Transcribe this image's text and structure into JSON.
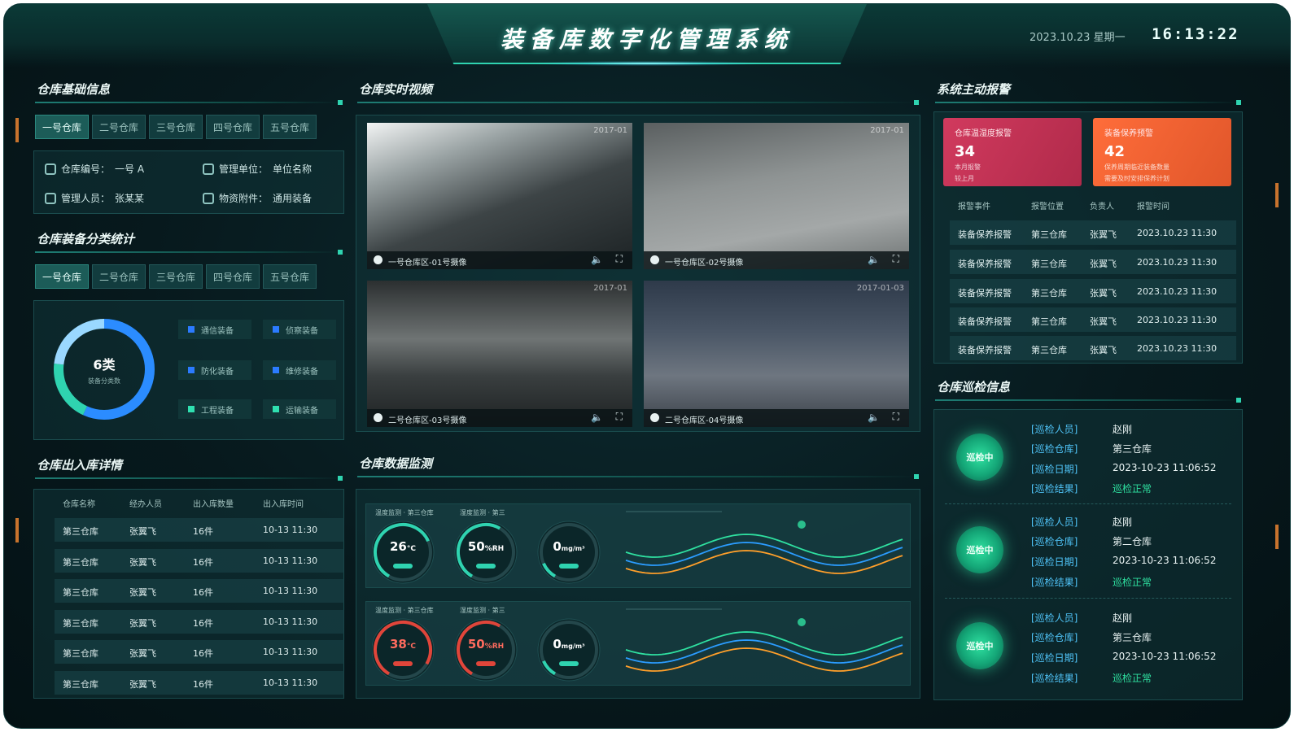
{
  "header": {
    "title": "装备库数字化管理系统",
    "date": "2023.10.23  星期一",
    "time": "16:13:22"
  },
  "basic_info": {
    "title": "仓库基础信息",
    "tabs": [
      "一号仓库",
      "二号仓库",
      "三号仓库",
      "四号仓库",
      "五号仓库"
    ],
    "active_tab": 0,
    "fields": [
      {
        "label": "仓库编号：",
        "value": "一号 A"
      },
      {
        "label": "管理单位：",
        "value": "单位名称"
      },
      {
        "label": "管理人员：",
        "value": "张某某"
      },
      {
        "label": "物资附件：",
        "value": "通用装备"
      }
    ]
  },
  "category_stats": {
    "title": "仓库装备分类统计",
    "tabs": [
      "一号仓库",
      "二号仓库",
      "三号仓库",
      "四号仓库",
      "五号仓库"
    ],
    "active_tab": 0,
    "center_value": "6类",
    "center_label": "装备分类数",
    "legend": [
      {
        "name": "通信装备",
        "color": "#2b7bff"
      },
      {
        "name": "侦察装备",
        "color": "#2b7bff"
      },
      {
        "name": "防化装备",
        "color": "#2b7bff"
      },
      {
        "name": "维修装备",
        "color": "#2b7bff"
      },
      {
        "name": "工程装备",
        "color": "#2fe0b0"
      },
      {
        "name": "运输装备",
        "color": "#2fe0b0"
      }
    ],
    "donut_colors": [
      "#2fd3b0",
      "#2b8cff",
      "#7fd4ff"
    ]
  },
  "inout": {
    "title": "仓库出入库详情",
    "headers": [
      "仓库名称",
      "经办人员",
      "出入库数量",
      "出入库时间"
    ],
    "rows": [
      [
        "第三仓库",
        "张翼飞",
        "16件",
        "10-13 11:30"
      ],
      [
        "第三仓库",
        "张翼飞",
        "16件",
        "10-13 11:30"
      ],
      [
        "第三仓库",
        "张翼飞",
        "16件",
        "10-13 11:30"
      ],
      [
        "第三仓库",
        "张翼飞",
        "16件",
        "10-13 11:30"
      ],
      [
        "第三仓库",
        "张翼飞",
        "16件",
        "10-13 11:30"
      ],
      [
        "第三仓库",
        "张翼飞",
        "16件",
        "10-13 11:30"
      ]
    ]
  },
  "video": {
    "title": "仓库实时视频",
    "cams": [
      {
        "caption": "一号仓库区-01号摄像",
        "stamp": "2017-01"
      },
      {
        "caption": "一号仓库区-02号摄像",
        "stamp": "2017-01"
      },
      {
        "caption": "二号仓库区-03号摄像",
        "stamp": "2017-01"
      },
      {
        "caption": "二号仓库区-04号摄像",
        "stamp": "2017-01-03"
      }
    ],
    "vol_icon": "🔈",
    "full_icon": "⛶"
  },
  "env": {
    "title": "仓库数据监测",
    "groups": [
      {
        "label_a": "温度监测 · 第三仓库",
        "label_b": "湿度监测 · 第三",
        "gauges": [
          {
            "value": "26",
            "unit": "°C",
            "color": "#2fd3b0",
            "level": 0.6
          },
          {
            "value": "50",
            "unit": "%RH",
            "color": "#2fd3b0",
            "level": 0.5
          },
          {
            "value": "0",
            "unit": "mg/m³",
            "color": "#2fd3b0",
            "level": 0.1
          }
        ]
      },
      {
        "label_a": "温度监测 · 第三仓库",
        "label_b": "湿度监测 · 第三",
        "gauges": [
          {
            "value": "38",
            "unit": "°C",
            "color": "#e0453a",
            "level": 0.75
          },
          {
            "value": "50",
            "unit": "%RH",
            "color": "#e0453a",
            "level": 0.5
          },
          {
            "value": "0",
            "unit": "mg/m³",
            "color": "#2fd3b0",
            "level": 0.1
          }
        ]
      }
    ]
  },
  "alarm": {
    "title": "系统主动报警",
    "cards": [
      {
        "label": "仓库温湿度报警",
        "value": "34",
        "sub1": "本月报警",
        "sub2": "较上月"
      },
      {
        "label": "装备保养预警",
        "value": "42",
        "sub1": "保养周期临近装备数量",
        "sub2": "需要及时安排保养计划"
      }
    ],
    "headers": [
      "报警事件",
      "报警位置",
      "负责人",
      "报警时间"
    ],
    "rows": [
      [
        "装备保养报警",
        "第三仓库",
        "张翼飞",
        "2023.10.23 11:30"
      ],
      [
        "装备保养报警",
        "第三仓库",
        "张翼飞",
        "2023.10.23 11:30"
      ],
      [
        "装备保养报警",
        "第三仓库",
        "张翼飞",
        "2023.10.23 11:30"
      ],
      [
        "装备保养报警",
        "第三仓库",
        "张翼飞",
        "2023.10.23 11:30"
      ],
      [
        "装备保养报警",
        "第三仓库",
        "张翼飞",
        "2023.10.23 11:30"
      ]
    ]
  },
  "patrol": {
    "title": "仓库巡检信息",
    "badge": "巡检中",
    "keys": [
      "[巡检人员]",
      "[巡检仓库]",
      "[巡检日期]",
      "[巡检结果]"
    ],
    "items": [
      {
        "person": "赵刚",
        "warehouse": "第三仓库",
        "date": "2023-10-23 11:06:52",
        "result": "巡检正常"
      },
      {
        "person": "赵刚",
        "warehouse": "第二仓库",
        "date": "2023-10-23 11:06:52",
        "result": "巡检正常"
      },
      {
        "person": "赵刚",
        "warehouse": "第三仓库",
        "date": "2023-10-23 11:06:52",
        "result": "巡检正常"
      }
    ]
  }
}
